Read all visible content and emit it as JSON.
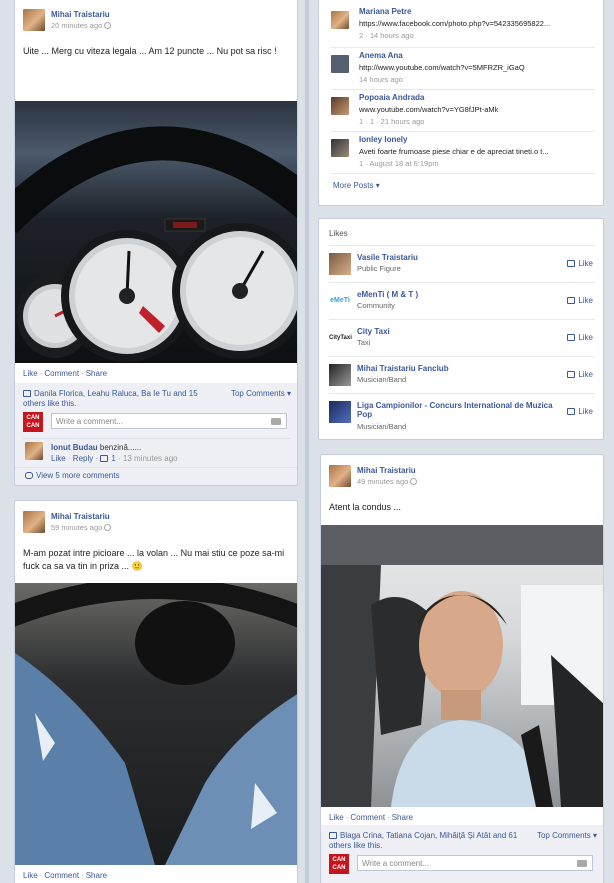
{
  "post1": {
    "author": "Mihai Traistariu",
    "time": "20 minutes ago",
    "text": "Uite ... Merg cu viteza legala ... Am 12 puncte ... Nu pot sa risc !",
    "actions": {
      "like": "Like",
      "comment": "Comment",
      "share": "Share"
    },
    "likes_text": "Danila Florica, Leahu Raluca, Ba Ie Tu and 15 others like this.",
    "top_comments": "Top Comments",
    "comment_placeholder": "Write a comment...",
    "comment": {
      "author": "Ionut Budau",
      "text": "benzină......",
      "like": "Like",
      "reply": "Reply",
      "likes": "1",
      "time": "13 minutes ago"
    },
    "view_more": "View 5 more comments"
  },
  "post2": {
    "author": "Mihai Traistariu",
    "time": "59 minutes ago",
    "text": "M-am pozat intre picioare ... la volan ... Nu mai stiu ce poze sa-mi fuck ca sa va tin in priza ... 🙂",
    "actions": {
      "like": "Like",
      "comment": "Comment",
      "share": "Share"
    }
  },
  "activity": {
    "items": [
      {
        "name": "Mariana Petre",
        "line": "https://www.facebook.com/photo.php?v=542335695822...",
        "meta": "2 · 14 hours ago"
      },
      {
        "name": "Anema Ana",
        "line": "http://www.youtube.com/watch?v=5MFRZR_iGaQ",
        "meta": "14 hours ago"
      },
      {
        "name": "Popoaia Andrada",
        "line": "www.youtube.com/watch?v=YG8fJPt-aMk",
        "meta": "1 · 1 · 21 hours ago"
      },
      {
        "name": "Ionley Ionely",
        "line": "Aveti foarte frumoase piese chiar e de apreciat tineti.o t...",
        "meta": "1 · August 18 at 6:19pm"
      }
    ],
    "more_posts": "More Posts"
  },
  "likes": {
    "header": "Likes",
    "items": [
      {
        "name": "Vasile Traistariu",
        "category": "Public Figure",
        "button": "Like"
      },
      {
        "name": "eMenTi ( M & T )",
        "category": "Community",
        "button": "Like"
      },
      {
        "name": "City Taxi",
        "category": "Taxi",
        "button": "Like"
      },
      {
        "name": "Mihai Traistariu Fanclub",
        "category": "Musician/Band",
        "button": "Like"
      },
      {
        "name": "Liga Campionilor - Concurs International de Muzica Pop",
        "category": "Musician/Band",
        "button": "Like"
      }
    ]
  },
  "post3": {
    "author": "Mihai Traistariu",
    "time": "49 minutes ago",
    "text": "Atent la condus ...",
    "actions": {
      "like": "Like",
      "comment": "Comment",
      "share": "Share"
    },
    "likes_text": "Blaga Crina, Tatiana Cojan, Mihăiță Și Atât and 61 others like this.",
    "top_comments": "Top Comments",
    "comment_placeholder": "Write a comment..."
  }
}
